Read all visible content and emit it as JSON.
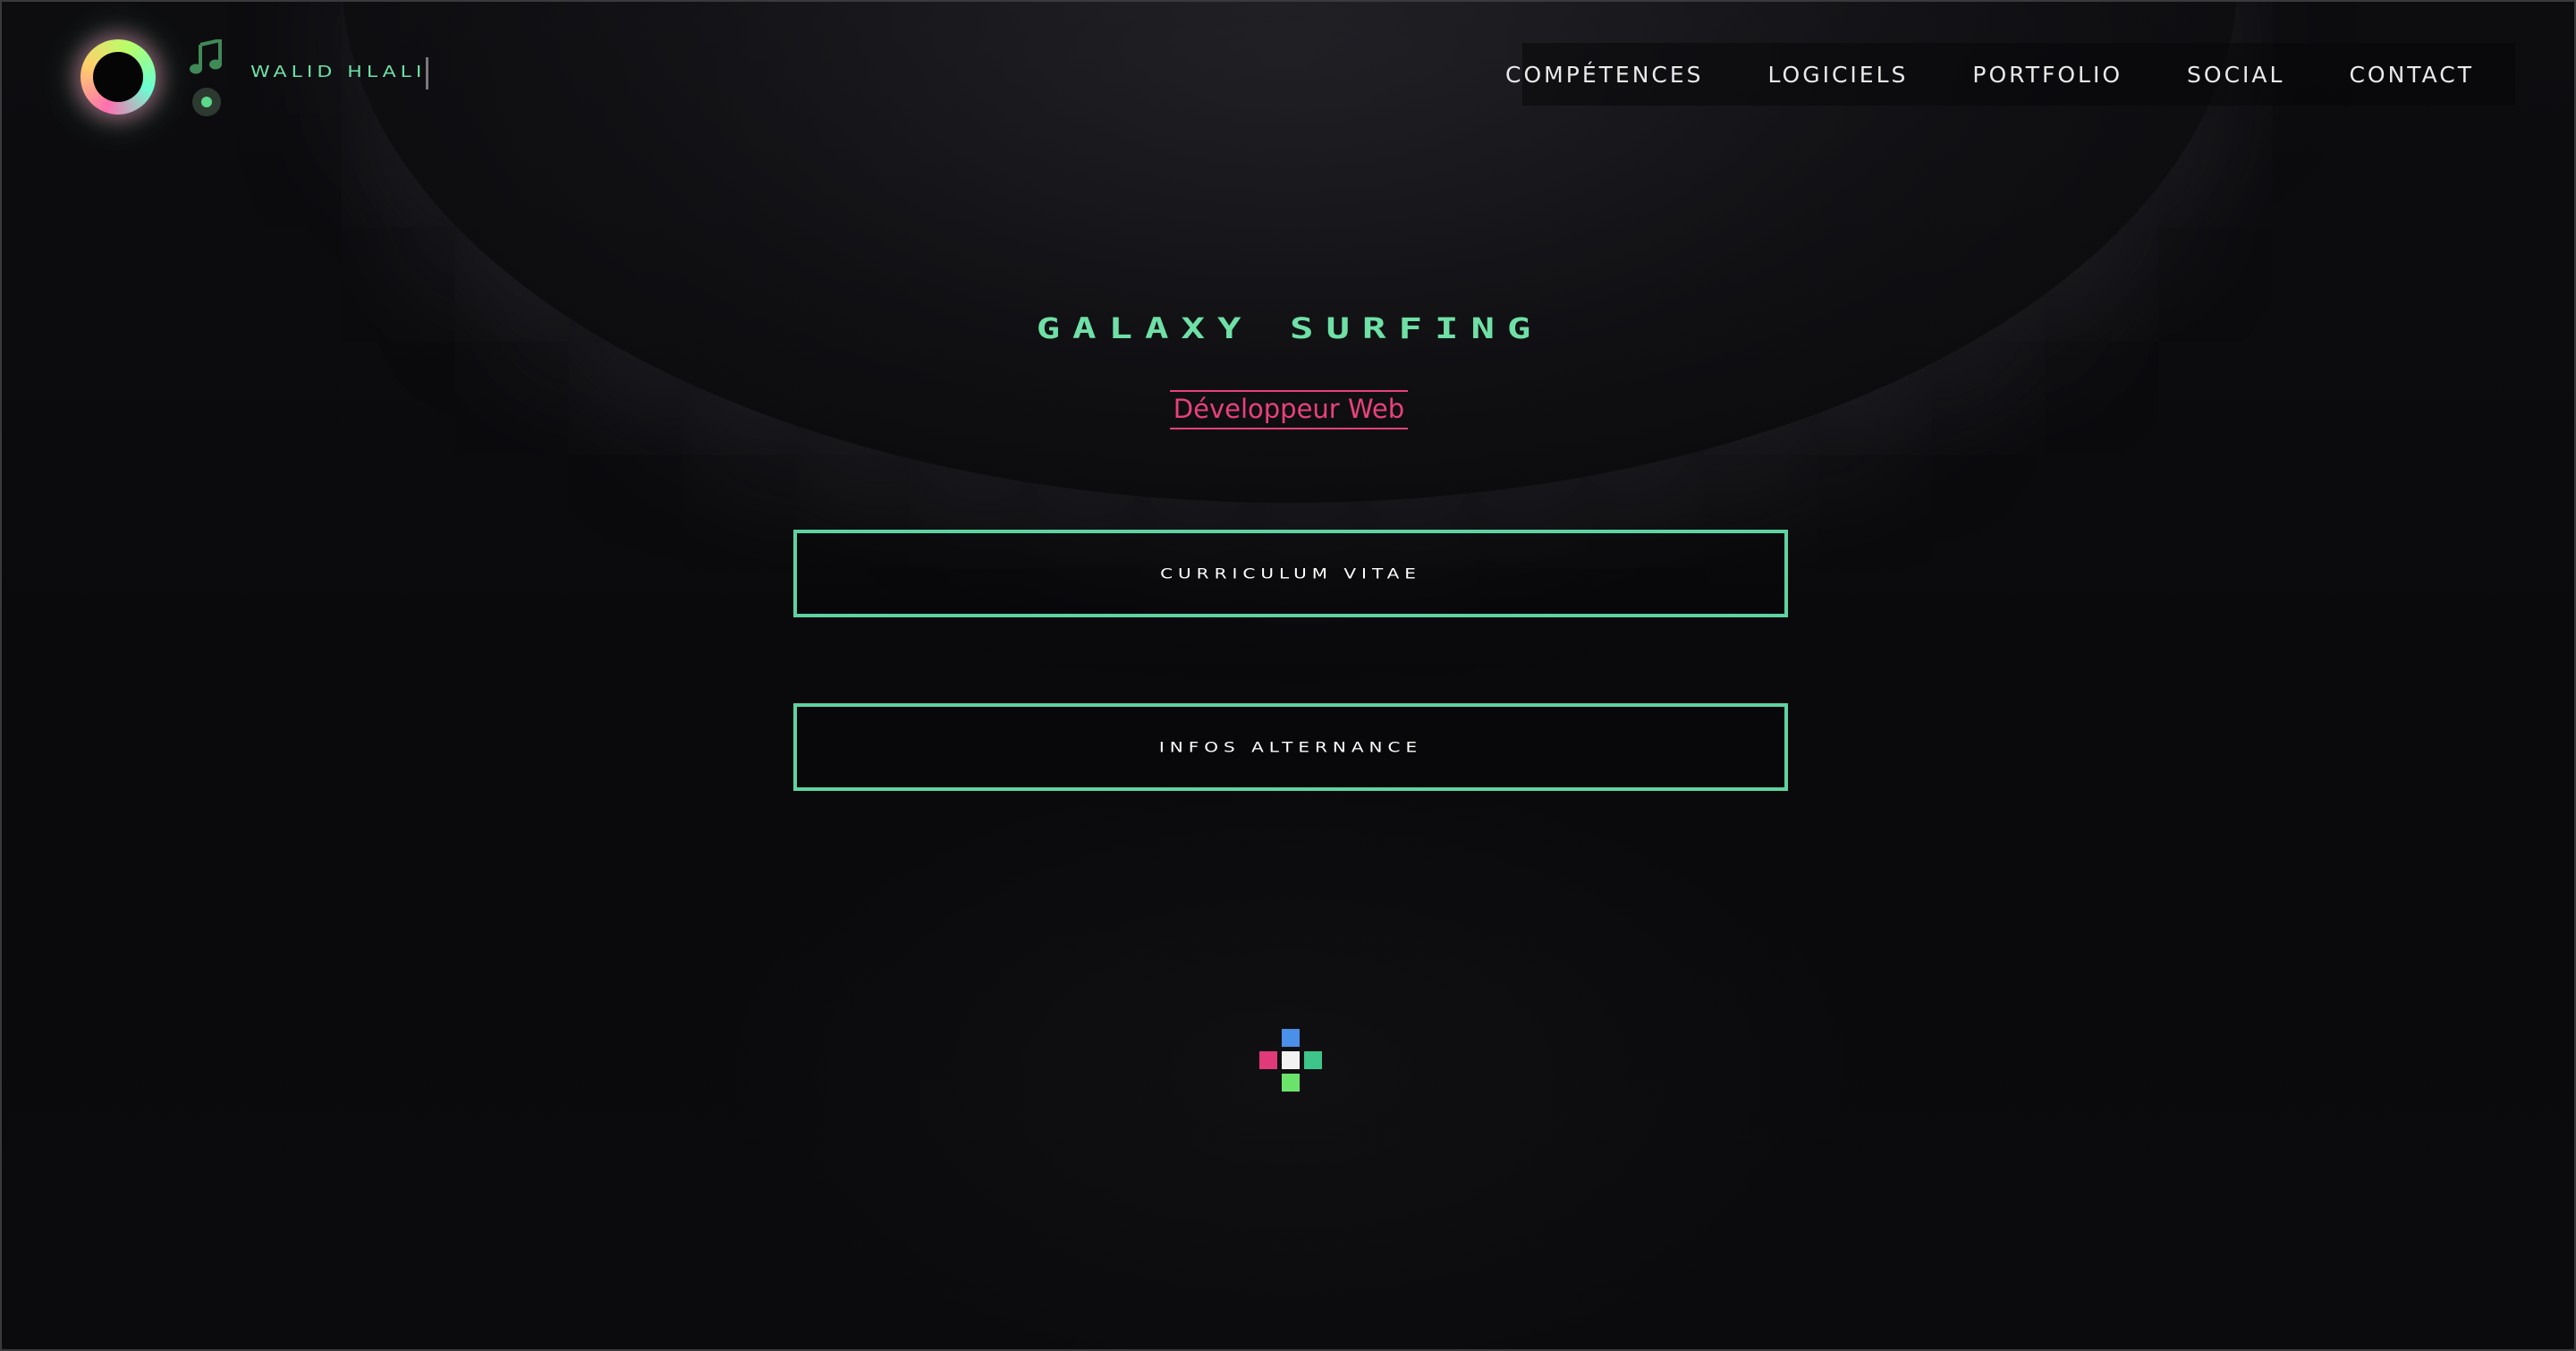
{
  "brand": {
    "name": "Walid Hlali"
  },
  "header": {
    "nav": [
      {
        "label": "Compétences"
      },
      {
        "label": "Logiciels"
      },
      {
        "label": "Portfolio"
      },
      {
        "label": "Social"
      },
      {
        "label": "Contact"
      }
    ],
    "icons": [
      "logo-ring-icon",
      "music-note-icon",
      "disc-icon"
    ]
  },
  "hero": {
    "title": "Galaxy Surfing",
    "subtitle": "Développeur Web"
  },
  "actions": {
    "cv_label": "Curriculum Vitae",
    "alternance_label": "Infos Alternance"
  },
  "colors": {
    "accent_green": "#6fe0a6",
    "button_border": "#5fd3a0",
    "accent_pink": "#e9417c",
    "loader_blue": "#4a8fe8",
    "loader_pink": "#e03a7a",
    "loader_white": "#f2f2f2",
    "loader_teal": "#3ec58a",
    "loader_green": "#6be36b",
    "background": "#0b0b0d"
  }
}
